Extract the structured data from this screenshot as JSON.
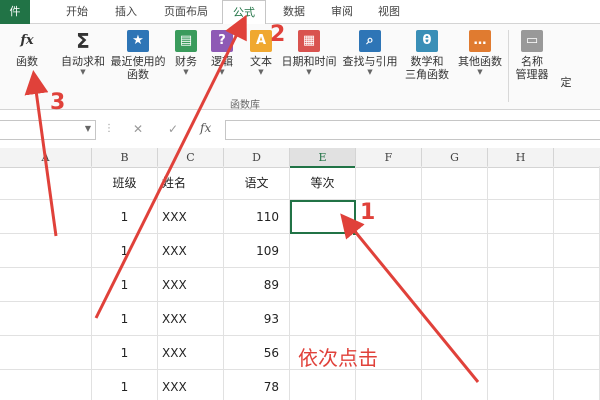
{
  "tabs": [
    {
      "label": "件",
      "state": "file"
    },
    {
      "label": "开始"
    },
    {
      "label": "插入"
    },
    {
      "label": "页面布局"
    },
    {
      "label": "公式",
      "state": "active"
    },
    {
      "label": "数据"
    },
    {
      "label": "审阅"
    },
    {
      "label": "视图"
    }
  ],
  "ribbon": {
    "partial_left": {
      "glyph": "fx",
      "label": "函数"
    },
    "buttons": [
      {
        "label1": "自动求和",
        "label2": "",
        "icon": "sum-icon",
        "glyph": "Σ"
      },
      {
        "label1": "最近使用的",
        "label2": "函数",
        "icon": "recent-functions-icon",
        "glyph": "★"
      },
      {
        "label1": "财务",
        "label2": "",
        "icon": "financial-icon",
        "glyph": "▤"
      },
      {
        "label1": "逻辑",
        "label2": "",
        "icon": "logical-icon",
        "glyph": "?"
      },
      {
        "label1": "文本",
        "label2": "",
        "icon": "text-icon",
        "glyph": "A"
      },
      {
        "label1": "日期和时间",
        "label2": "",
        "icon": "date-time-icon",
        "glyph": "▦"
      },
      {
        "label1": "查找与引用",
        "label2": "",
        "icon": "lookup-icon",
        "glyph": "⌕"
      },
      {
        "label1": "数学和",
        "label2": "三角函数",
        "icon": "math-trig-icon",
        "glyph": "θ"
      },
      {
        "label1": "其他函数",
        "label2": "",
        "icon": "more-functions-icon",
        "glyph": "…"
      }
    ],
    "group_label": "函数库",
    "name_manager": {
      "label1": "名称",
      "label2": "管理器"
    },
    "partial_right": {
      "label": "定"
    }
  },
  "formula_bar": {
    "fx": "fx",
    "cancel": "✕",
    "enter": "✓",
    "dots": "⋮"
  },
  "columns": [
    "A",
    "B",
    "C",
    "D",
    "E",
    "F",
    "G",
    "H"
  ],
  "selected_column": "E",
  "table": {
    "headers": [
      "班级",
      "姓名",
      "语文",
      "等次"
    ],
    "rows": [
      [
        "1",
        "XXX",
        "110",
        ""
      ],
      [
        "1",
        "XXX",
        "109",
        ""
      ],
      [
        "1",
        "XXX",
        "89",
        ""
      ],
      [
        "1",
        "XXX",
        "93",
        ""
      ],
      [
        "1",
        "XXX",
        "56",
        ""
      ],
      [
        "1",
        "XXX",
        "78",
        ""
      ]
    ]
  },
  "annotations": {
    "step1": "1",
    "step2": "2",
    "step3": "3",
    "caption": "依次点击",
    "color": "#e0413a"
  },
  "colors": {
    "accent": "#217346",
    "annotation": "#e0413a"
  }
}
